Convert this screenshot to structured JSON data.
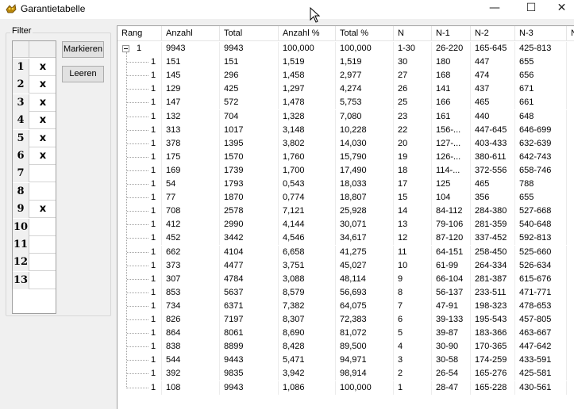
{
  "window": {
    "title": "Garantietabelle",
    "icon": "app-icon",
    "minimize": "—",
    "maximize": "☐",
    "close": "✕"
  },
  "filter": {
    "legend": "Filter",
    "rows": [
      {
        "num": "1",
        "mark": "x"
      },
      {
        "num": "2",
        "mark": "x"
      },
      {
        "num": "3",
        "mark": "x"
      },
      {
        "num": "4",
        "mark": "x"
      },
      {
        "num": "5",
        "mark": "x"
      },
      {
        "num": "6",
        "mark": "x"
      },
      {
        "num": "7",
        "mark": ""
      },
      {
        "num": "8",
        "mark": ""
      },
      {
        "num": "9",
        "mark": "x"
      },
      {
        "num": "10",
        "mark": ""
      },
      {
        "num": "11",
        "mark": ""
      },
      {
        "num": "12",
        "mark": ""
      },
      {
        "num": "13",
        "mark": ""
      }
    ],
    "markieren_label": "Markieren",
    "leeren_label": "Leeren"
  },
  "table": {
    "columns": [
      "Rang",
      "Anzahl",
      "Total",
      "Anzahl %",
      "Total %",
      "N",
      "N-1",
      "N-2",
      "N-3",
      "N"
    ],
    "root": [
      "1",
      "9943",
      "9943",
      "100,000",
      "100,000",
      "1-30",
      "26-220",
      "165-645",
      "425-813"
    ],
    "rows": [
      [
        "1",
        "151",
        "151",
        "1,519",
        "1,519",
        "30",
        "180",
        "447",
        "655"
      ],
      [
        "1",
        "145",
        "296",
        "1,458",
        "2,977",
        "27",
        "168",
        "474",
        "656"
      ],
      [
        "1",
        "129",
        "425",
        "1,297",
        "4,274",
        "26",
        "141",
        "437",
        "671"
      ],
      [
        "1",
        "147",
        "572",
        "1,478",
        "5,753",
        "25",
        "166",
        "465",
        "661"
      ],
      [
        "1",
        "132",
        "704",
        "1,328",
        "7,080",
        "23",
        "161",
        "440",
        "648"
      ],
      [
        "1",
        "313",
        "1017",
        "3,148",
        "10,228",
        "22",
        "156-...",
        "447-645",
        "646-699"
      ],
      [
        "1",
        "378",
        "1395",
        "3,802",
        "14,030",
        "20",
        "127-...",
        "403-433",
        "632-639"
      ],
      [
        "1",
        "175",
        "1570",
        "1,760",
        "15,790",
        "19",
        "126-...",
        "380-611",
        "642-743"
      ],
      [
        "1",
        "169",
        "1739",
        "1,700",
        "17,490",
        "18",
        "114-...",
        "372-556",
        "658-746"
      ],
      [
        "1",
        "54",
        "1793",
        "0,543",
        "18,033",
        "17",
        "125",
        "465",
        "788"
      ],
      [
        "1",
        "77",
        "1870",
        "0,774",
        "18,807",
        "15",
        "104",
        "356",
        "655"
      ],
      [
        "1",
        "708",
        "2578",
        "7,121",
        "25,928",
        "14",
        "84-112",
        "284-380",
        "527-668"
      ],
      [
        "1",
        "412",
        "2990",
        "4,144",
        "30,071",
        "13",
        "79-106",
        "281-359",
        "540-648"
      ],
      [
        "1",
        "452",
        "3442",
        "4,546",
        "34,617",
        "12",
        "87-120",
        "337-452",
        "592-813"
      ],
      [
        "1",
        "662",
        "4104",
        "6,658",
        "41,275",
        "11",
        "64-151",
        "258-450",
        "525-660"
      ],
      [
        "1",
        "373",
        "4477",
        "3,751",
        "45,027",
        "10",
        "61-99",
        "264-334",
        "526-634"
      ],
      [
        "1",
        "307",
        "4784",
        "3,088",
        "48,114",
        "9",
        "66-104",
        "281-387",
        "615-676"
      ],
      [
        "1",
        "853",
        "5637",
        "8,579",
        "56,693",
        "8",
        "56-137",
        "233-511",
        "471-771"
      ],
      [
        "1",
        "734",
        "6371",
        "7,382",
        "64,075",
        "7",
        "47-91",
        "198-323",
        "478-653"
      ],
      [
        "1",
        "826",
        "7197",
        "8,307",
        "72,383",
        "6",
        "39-133",
        "195-543",
        "457-805"
      ],
      [
        "1",
        "864",
        "8061",
        "8,690",
        "81,072",
        "5",
        "39-87",
        "183-366",
        "463-667"
      ],
      [
        "1",
        "838",
        "8899",
        "8,428",
        "89,500",
        "4",
        "30-90",
        "170-365",
        "447-642"
      ],
      [
        "1",
        "544",
        "9443",
        "5,471",
        "94,971",
        "3",
        "30-58",
        "174-259",
        "433-591"
      ],
      [
        "1",
        "392",
        "9835",
        "3,942",
        "98,914",
        "2",
        "26-54",
        "165-276",
        "425-581"
      ],
      [
        "1",
        "108",
        "9943",
        "1,086",
        "100,000",
        "1",
        "28-47",
        "165-228",
        "430-561"
      ]
    ]
  }
}
